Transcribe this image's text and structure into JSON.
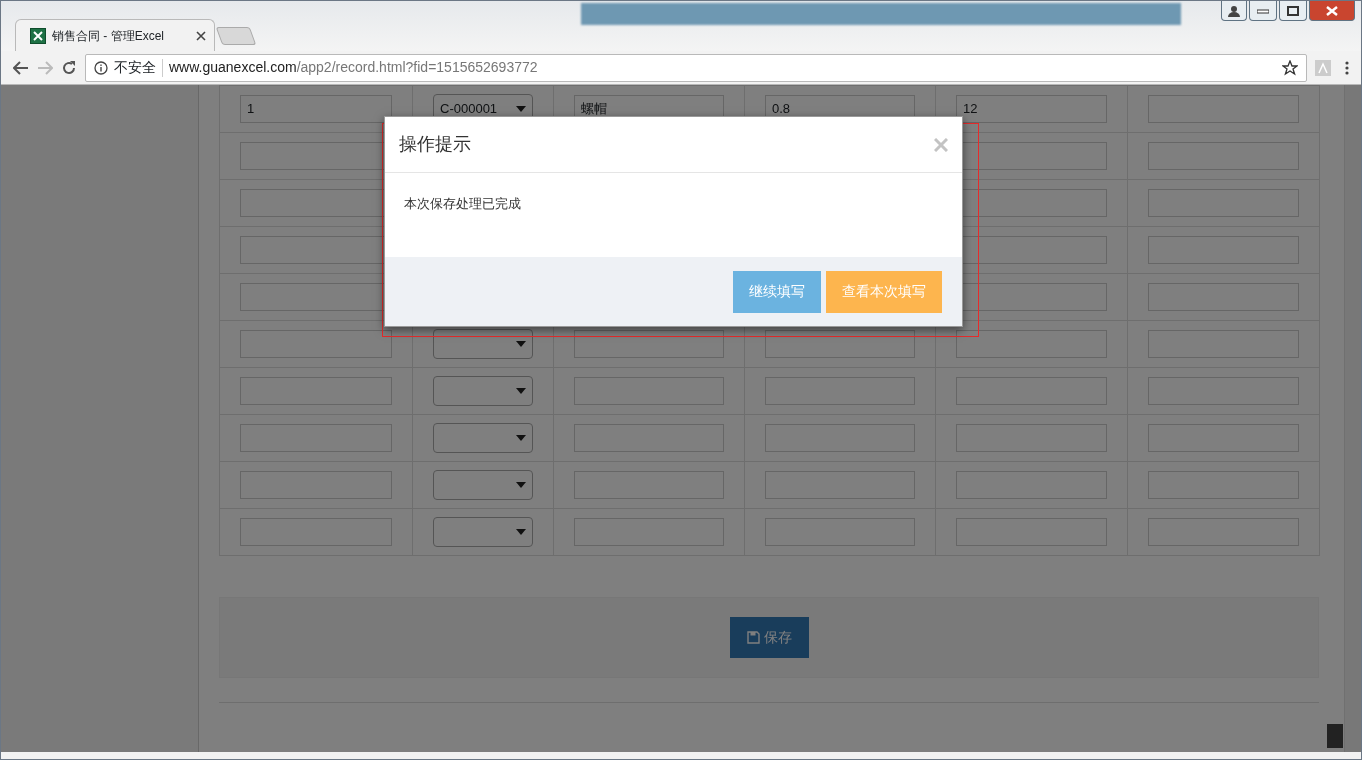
{
  "browser": {
    "tab_title": "销售合同 - 管理Excel",
    "security_label": "不安全",
    "url_host": "www.guanexcel.com",
    "url_path": "/app2/record.html?fid=1515652693772"
  },
  "table": {
    "rows": [
      {
        "column_1": "1",
        "column_2": "C-000001",
        "column_3": "螺帽",
        "column_4": "0.8",
        "column_5": "12"
      },
      {},
      {},
      {},
      {},
      {},
      {},
      {},
      {},
      {}
    ]
  },
  "save_button": {
    "label": "保存"
  },
  "dialog": {
    "title": "操作提示",
    "message": "本次保存处理已完成",
    "buttons": [
      {
        "label": "继续填写",
        "kind": "info"
      },
      {
        "label": "查看本次填写",
        "kind": "warning"
      }
    ]
  }
}
